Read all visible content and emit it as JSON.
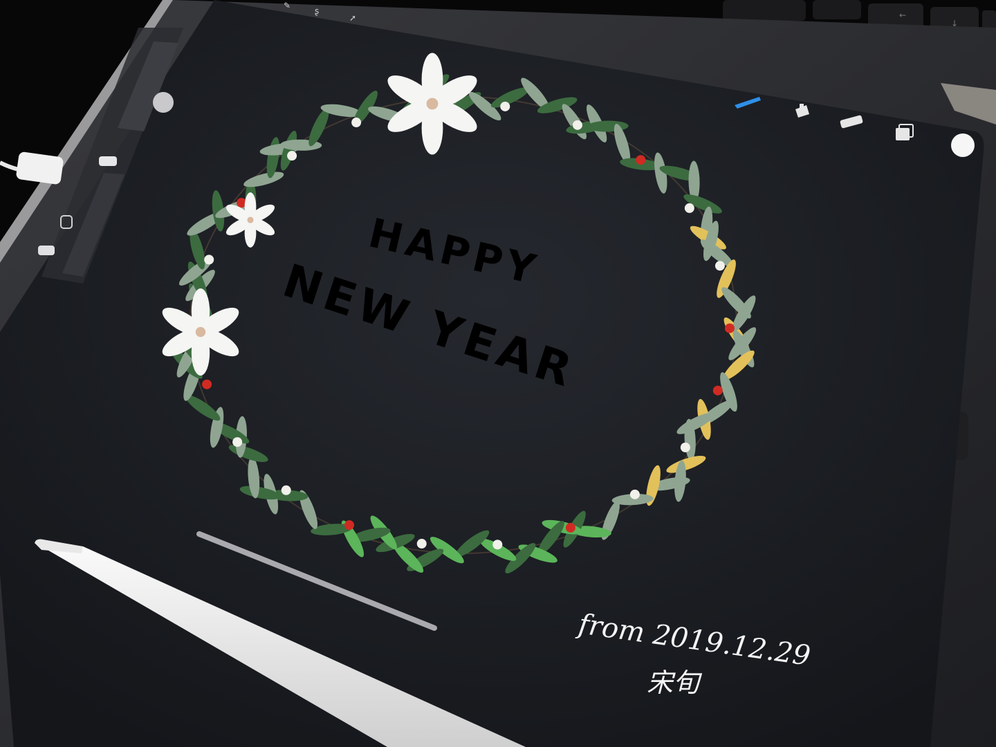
{
  "artwork": {
    "headline_line1": "HAPPY",
    "headline_line2": "NEW YEAR",
    "signature_date": "from 2019.12.29",
    "signature_name": "宋旬"
  },
  "toolbar": {
    "brush_icon": "brush-icon",
    "smudge_icon": "smudge-icon",
    "eraser_icon": "eraser-icon",
    "layers_icon": "layers-icon",
    "color_icon": "color-swatch-icon"
  },
  "sidebar": {
    "size_slider": "brush-size-slider",
    "modify_button": "modify-button",
    "opacity_slider": "opacity-slider",
    "undo": "undo-button",
    "redo": "redo-button"
  },
  "colors": {
    "title": "#3f7a3a",
    "canvas": "#1b1d22",
    "leaf_light": "#8fa592",
    "leaf_bright": "#5cb55a",
    "leaf_dark": "#3c6b3f",
    "leaf_yellow": "#e3c15a",
    "berry": "#d02b22",
    "flower": "#f5f5f3"
  }
}
